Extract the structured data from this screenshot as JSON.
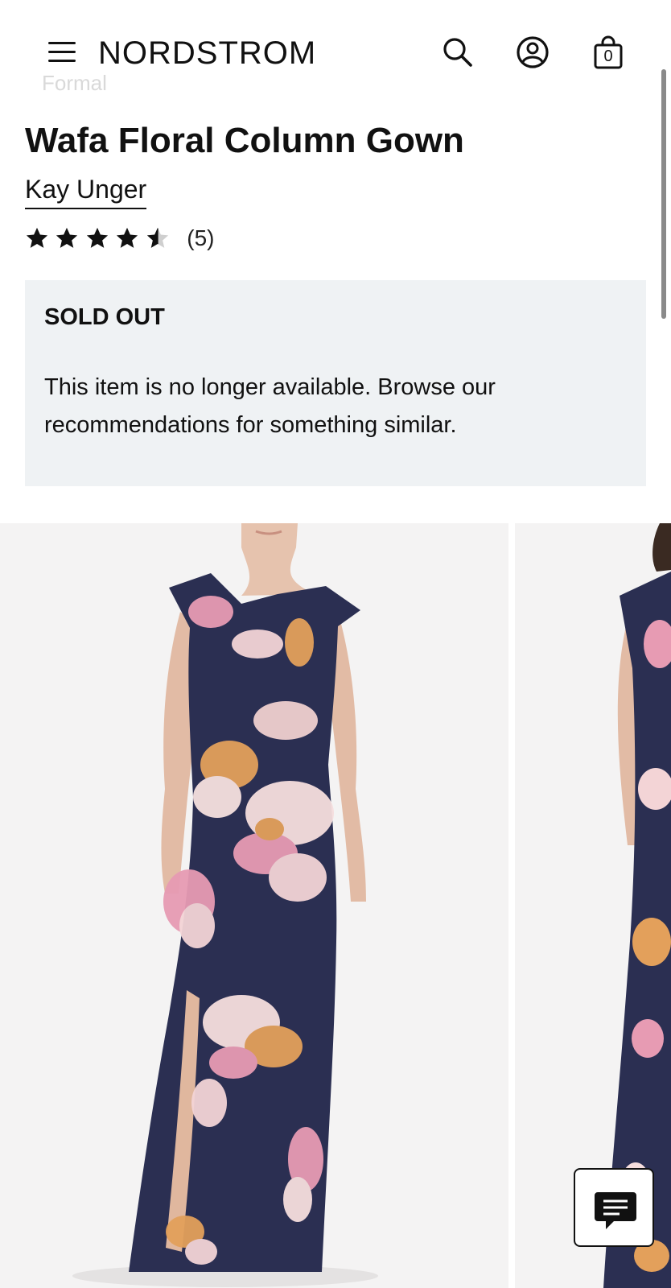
{
  "header": {
    "logo": "NORDSTROM",
    "bag_count": "0",
    "breadcrumb_partial": "Formal"
  },
  "product": {
    "title": "Wafa Floral Column Gown",
    "brand": "Kay Unger",
    "rating": 4.5,
    "rating_max": 5,
    "review_count": "(5)"
  },
  "availability": {
    "heading": "SOLD OUT",
    "message": "This item is no longer available. Browse our recommendations for something similar."
  },
  "icons": {
    "menu": "hamburger-icon",
    "search": "search-icon",
    "account": "account-icon",
    "bag": "shopping-bag-icon",
    "chat": "chat-icon"
  },
  "colors": {
    "panel_bg": "#eff2f4",
    "dress_navy": "#2b2f52",
    "floral_pink": "#e79bb3",
    "floral_orange": "#e3a05b"
  }
}
